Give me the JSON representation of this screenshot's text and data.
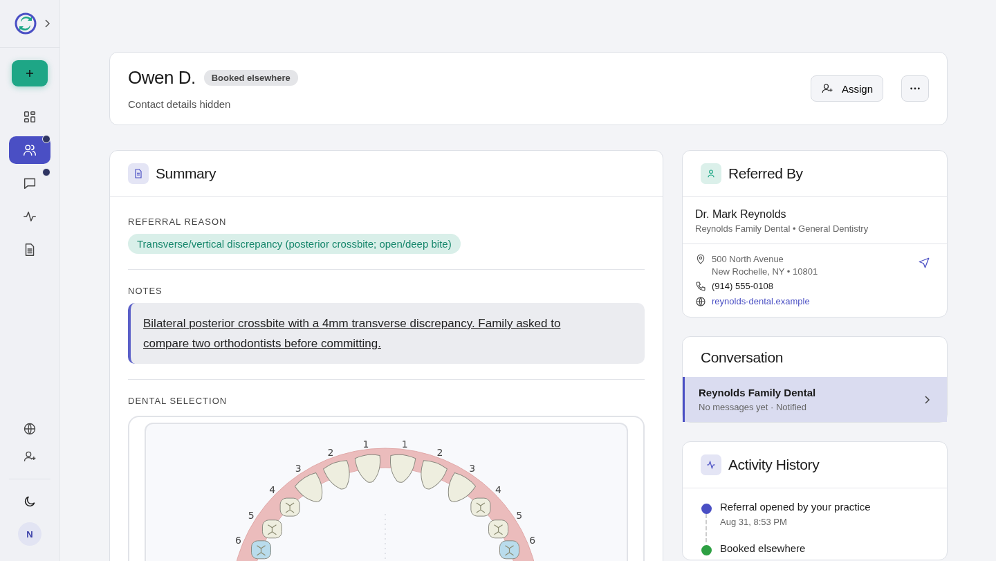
{
  "sidebar": {
    "nav": [
      {
        "selected": false,
        "badge": false
      },
      {
        "selected": true,
        "badge": true
      },
      {
        "selected": false,
        "badge": true
      },
      {
        "selected": false,
        "badge": false
      },
      {
        "selected": false,
        "badge": false
      }
    ],
    "avatar": "N"
  },
  "patient": {
    "name": "Owen D.",
    "status": "Booked elsewhere",
    "subtitle": "Contact details hidden",
    "assign_label": "Assign"
  },
  "summary": {
    "title": "Summary",
    "reason_label": "REFERRAL REASON",
    "reason": "Transverse/vertical discrepancy (posterior crossbite; open/deep bite)",
    "notes_label": "NOTES",
    "notes": "Bilateral posterior crossbite with a 4mm transverse discrepancy. Family asked to compare two orthodontists before committing.",
    "dental_label": "DENTAL SELECTION",
    "teeth_left": [
      {
        "number": "1",
        "selected": false
      },
      {
        "number": "2",
        "selected": false
      },
      {
        "number": "3",
        "selected": false
      },
      {
        "number": "4",
        "selected": false
      },
      {
        "number": "5",
        "selected": false
      },
      {
        "number": "6",
        "selected": true
      }
    ],
    "teeth_right": [
      {
        "number": "1",
        "selected": false
      },
      {
        "number": "2",
        "selected": false
      },
      {
        "number": "3",
        "selected": false
      },
      {
        "number": "4",
        "selected": false
      },
      {
        "number": "5",
        "selected": false
      },
      {
        "number": "6",
        "selected": true
      }
    ]
  },
  "referred_by": {
    "title": "Referred By",
    "doctor": "Dr. Mark Reynolds",
    "practice": "Reynolds Family Dental • General Dentistry",
    "address_line1": "500 North Avenue",
    "address_line2": "New Rochelle, NY • 10801",
    "phone": "(914) 555-0108",
    "website": "reynolds-dental.example"
  },
  "conversation": {
    "title": "Conversation",
    "items": [
      {
        "name": "Reynolds Family Dental",
        "status": "No messages yet · Notified",
        "selected": true
      }
    ]
  },
  "activity": {
    "title": "Activity History",
    "events": [
      {
        "label": "Referral opened by your practice",
        "time": "Aug 31, 8:53 PM",
        "color": "#4a4fc4"
      },
      {
        "label": "Booked elsewhere",
        "color": "#2ea043"
      }
    ]
  }
}
